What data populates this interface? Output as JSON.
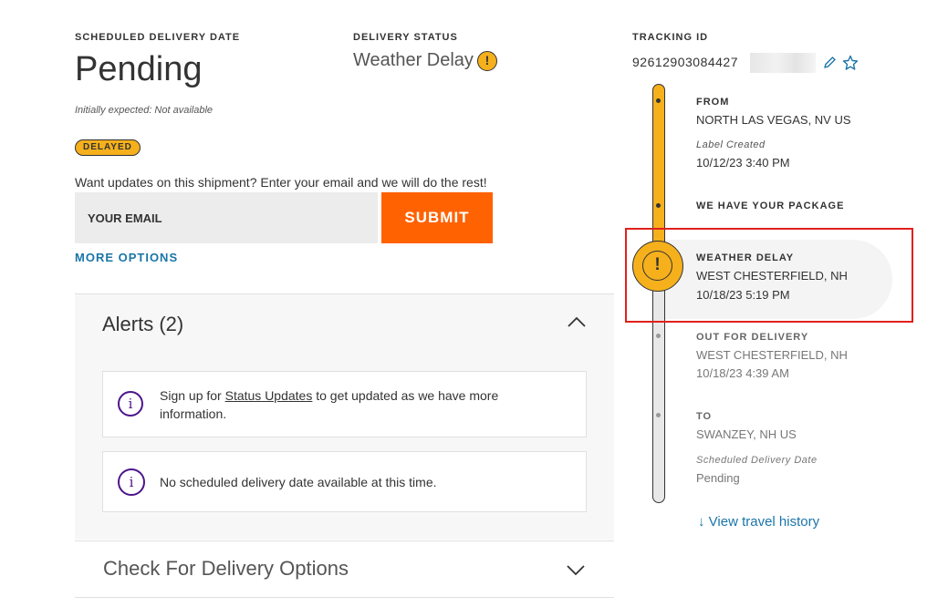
{
  "schedule": {
    "label": "SCHEDULED DELIVERY DATE",
    "value": "Pending",
    "initially": "Initially expected: Not available",
    "badge": "DELAYED"
  },
  "status": {
    "label": "DELIVERY STATUS",
    "value": "Weather Delay",
    "icon": "warning-icon"
  },
  "updates": {
    "prompt": "Want updates on this shipment? Enter your email and we will do the rest!",
    "email_placeholder": "YOUR EMAIL",
    "submit_label": "SUBMIT",
    "more_options": "MORE OPTIONS"
  },
  "alerts": {
    "title": "Alerts (2)",
    "items": [
      {
        "prefix": "Sign up for ",
        "link": "Status Updates",
        "suffix": " to get updated as we have more information.",
        "icon": "info-icon"
      },
      {
        "text": "No scheduled delivery date available at this time.",
        "icon": "info-icon"
      }
    ]
  },
  "delivery_options": {
    "title": "Check For Delivery Options"
  },
  "tracking": {
    "label": "TRACKING ID",
    "number": "92612903084427",
    "icons": [
      "pencil-icon",
      "star-icon"
    ]
  },
  "timeline": {
    "from": {
      "title": "FROM",
      "location": "NORTH LAS VEGAS, NV US",
      "sub_label": "Label Created",
      "datetime": "10/12/23 3:40 PM"
    },
    "have_package": {
      "title": "WE HAVE YOUR PACKAGE"
    },
    "current": {
      "title": "WEATHER DELAY",
      "location": "WEST CHESTERFIELD, NH",
      "datetime": "10/18/23 5:19 PM"
    },
    "out_for_delivery": {
      "title": "OUT FOR DELIVERY",
      "location": "WEST CHESTERFIELD, NH",
      "datetime": "10/18/23 4:39 AM"
    },
    "to": {
      "title": "TO",
      "location": "SWANZEY, NH US",
      "sub_label": "Scheduled Delivery Date",
      "value": "Pending"
    }
  },
  "history_link": "View travel history",
  "colors": {
    "accent_orange": "#ff6200",
    "warning_yellow": "#f5b01c",
    "link_blue": "#1a75a8",
    "purple": "#4d148c",
    "highlight_red": "#e0201c"
  }
}
